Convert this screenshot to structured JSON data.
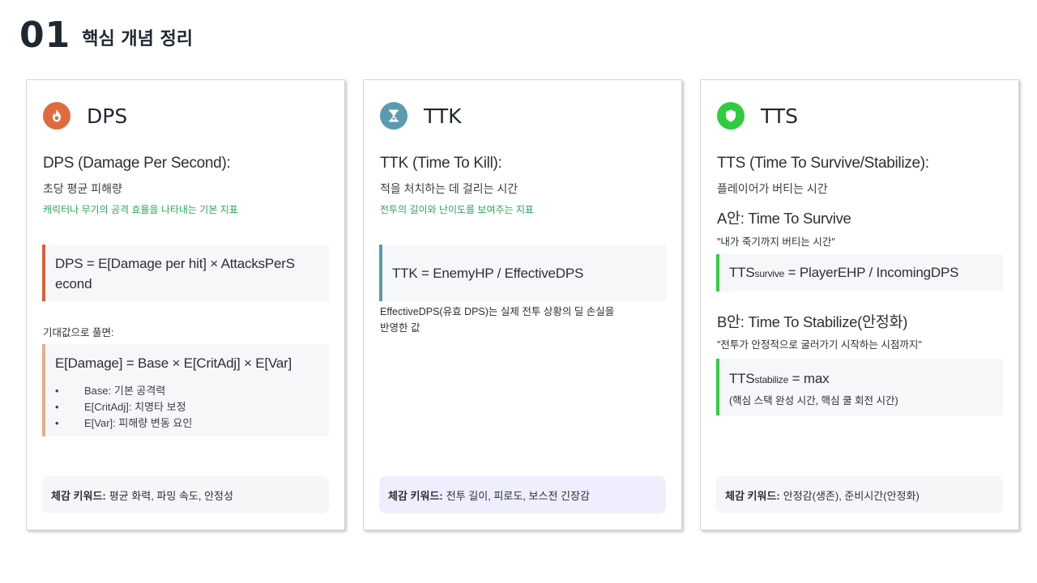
{
  "header": {
    "number": "01",
    "title": "핵심 개념 정리"
  },
  "colors": {
    "dps_accent": "#d8613b",
    "dps_accent_light": "#e8ab8a",
    "ttk_accent": "#5b9bb0",
    "tts_accent": "#33cc44",
    "highlight_text": "#2aa85a"
  },
  "cards": {
    "dps": {
      "icon": "fire-icon",
      "title": "DPS",
      "definition": "DPS (Damage Per Second):",
      "meaning": "초당 평균 피해량",
      "note": "캐릭터나 무기의 공격 효율을 나타내는 기본 지표",
      "formula_line1": "DPS = E[Damage per hit] × AttacksPerS",
      "formula_line2": "econd",
      "expand_label": "기대값으로 풀면:",
      "expanded_formula": "E[Damage] = Base × E[CritAdj] × E[Var]",
      "bullets": [
        "Base: 기본 공격력",
        "E[CritAdj]: 치명타 보정",
        "E[Var]: 피해량 변동 요인"
      ],
      "keyword_label": "체감 키워드:",
      "keywords": "평균 화력, 파밍 속도, 안정성"
    },
    "ttk": {
      "icon": "hourglass-icon",
      "title": "TTK",
      "definition": "TTK (Time To Kill):",
      "meaning": "적을 처치하는 데 걸리는 시간",
      "note": "전투의 길이와 난이도를 보여주는 지표",
      "formula": "TTK = EnemyHP / EffectiveDPS",
      "explain_line1": "EffectiveDPS(유효 DPS)는 실제 전투 상황의 딜 손실을",
      "explain_line2": "반영한 값",
      "keyword_label": "체감 키워드:",
      "keywords": "전투 길이, 피로도, 보스전 긴장감"
    },
    "tts": {
      "icon": "shield-icon",
      "title": "TTS",
      "definition": "TTS (Time To Survive/Stabilize):",
      "meaning": "플레이어가 버티는 시간",
      "a_title": "A안: Time To Survive",
      "a_quote": "\"내가 죽기까지 버티는 시간\"",
      "a_formula_main": "TTS",
      "a_formula_sub": "survive",
      "a_formula_rest": " = PlayerEHP / IncomingDPS",
      "b_title": "B안: Time To Stabilize(안정화)",
      "b_quote": "\"전투가 안정적으로 굴러가기 시작하는 시점까지\"",
      "b_formula_main": "TTS",
      "b_formula_sub": "stabilize",
      "b_formula_rest": " = max",
      "b_formula_note": "(핵심 스택 완성 시간, 핵심 쿨 회전 시간)",
      "keyword_label": "체감 키워드:",
      "keywords": "안정감(생존), 준비시간(안정화)"
    }
  }
}
